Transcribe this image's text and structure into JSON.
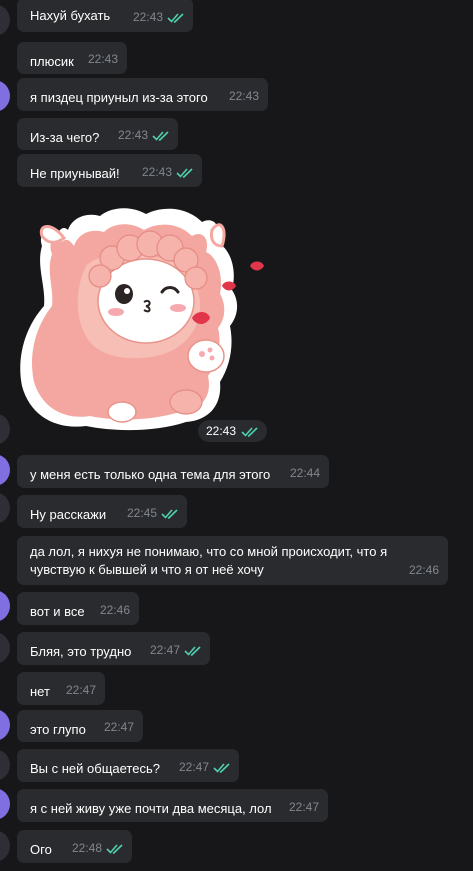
{
  "chat": {
    "messages": [
      {
        "text": "Нахуй бухать",
        "time": "22:43",
        "read": true
      },
      {
        "text": "плюсик",
        "time": "22:43",
        "read": false
      },
      {
        "text": "я пиздец приуныл из-за этого",
        "time": "22:43",
        "read": false
      },
      {
        "text": "Из-за чего?",
        "time": "22:43",
        "read": true
      },
      {
        "text": "Не приунывай!",
        "time": "22:43",
        "read": true
      },
      {
        "text": "у меня есть только одна тема для этого",
        "time": "22:44",
        "read": false
      },
      {
        "text": "Ну расскажи",
        "time": "22:45",
        "read": true
      },
      {
        "text": "да лол, я нихуя не понимаю, что со мной происходит, что я чувствую к бывшей и что я от неё хочу",
        "time": "22:46",
        "read": false
      },
      {
        "text": "вот и все",
        "time": "22:46",
        "read": false
      },
      {
        "text": "Бляя, это трудно",
        "time": "22:47",
        "read": true
      },
      {
        "text": "нет",
        "time": "22:47",
        "read": false
      },
      {
        "text": "это глупо",
        "time": "22:47",
        "read": false
      },
      {
        "text": "Вы с ней общаетесь?",
        "time": "22:47",
        "read": true
      },
      {
        "text": "я с ней живу уже почти два месяца, лол",
        "time": "22:47",
        "read": false
      },
      {
        "text": "Ого",
        "time": "22:48",
        "read": true
      }
    ],
    "sticker": {
      "time": "22:43",
      "read": true,
      "icon": "pink-alpaca-kiss-sticker"
    }
  },
  "colors": {
    "background": "#17171a",
    "bubble": "#2a2b2e",
    "check": "#4fd1b1",
    "avatar_purple": "#7f6fe0"
  }
}
